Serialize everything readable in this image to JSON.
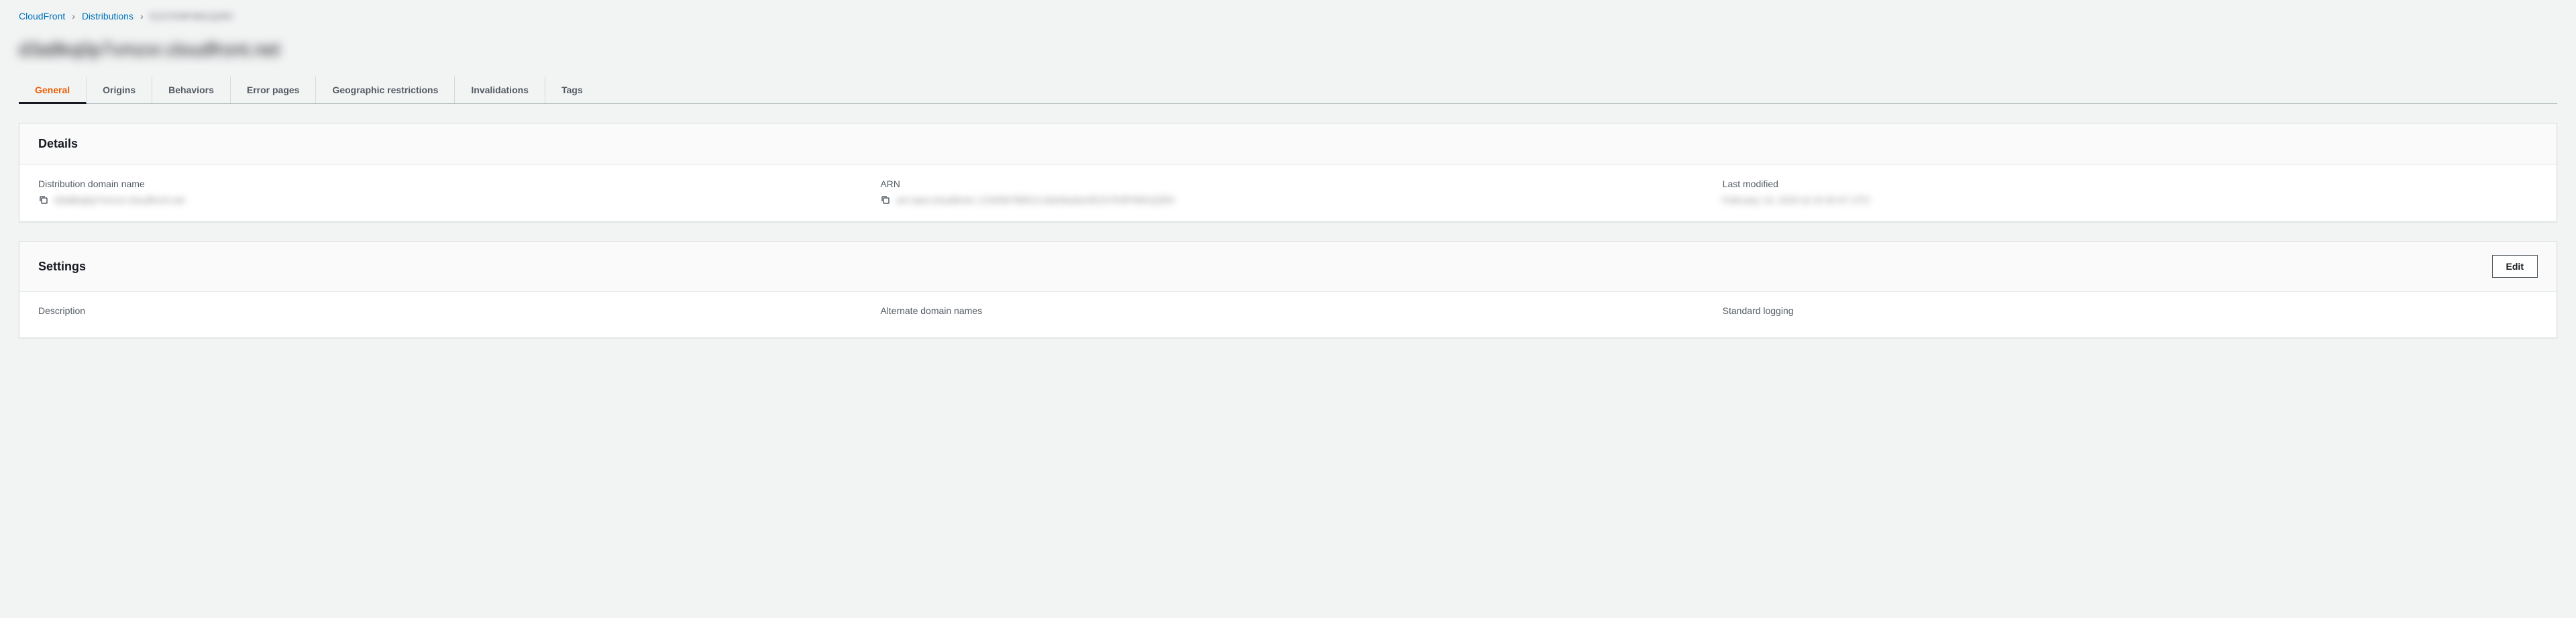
{
  "breadcrumbs": {
    "root": "CloudFront",
    "level1": "Distributions",
    "current": "E2X7K9P4M1QZ8V"
  },
  "page_title": "d3a8kq0p7vmzxr.cloudfront.net",
  "tabs": {
    "general": "General",
    "origins": "Origins",
    "behaviors": "Behaviors",
    "error_pages": "Error pages",
    "geographic_restrictions": "Geographic restrictions",
    "invalidations": "Invalidations",
    "tags": "Tags"
  },
  "details_panel": {
    "title": "Details",
    "domain_label": "Distribution domain name",
    "domain_value": "d3a8kq0p7vmzxr.cloudfront.net",
    "arn_label": "ARN",
    "arn_value": "arn:aws:cloudfront::123456789012:distribution/E2X7K9P4M1QZ8V",
    "last_modified_label": "Last modified",
    "last_modified_value": "February 14, 2024 at 10:32:47 UTC"
  },
  "settings_panel": {
    "title": "Settings",
    "edit_label": "Edit",
    "description_label": "Description",
    "alt_domains_label": "Alternate domain names",
    "standard_logging_label": "Standard logging"
  }
}
